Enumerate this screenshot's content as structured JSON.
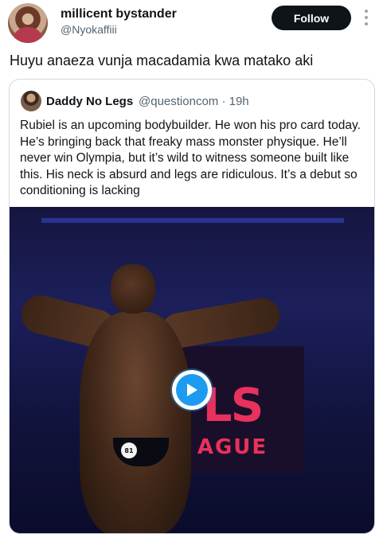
{
  "author": {
    "name": "millicent bystander",
    "handle": "@Nyokaffiii",
    "avatar_icon": "profile-avatar"
  },
  "follow_button": {
    "label": "Follow"
  },
  "more_icon": "more-vertical-icon",
  "tweet": {
    "text": "Huyu anaeza vunja macadamia kwa matako aki"
  },
  "quoted_tweet": {
    "author_name": "Daddy No Legs",
    "handle_time": "@questioncom · 19h",
    "body": "Rubiel is an upcoming bodybuilder. He won his pro card today. He’s bringing back that freaky mass monster physique. He’ll never win Olympia, but it’s wild to witness someone built like this. His neck is absurd and legs are ridiculous. It’s a debut so conditioning is lacking",
    "video": {
      "screen_text_top": "LS",
      "screen_text_bottom": "AGUE",
      "badge_number": "81",
      "play_icon": "play-icon",
      "accent_color": "#1d9bf0"
    }
  }
}
